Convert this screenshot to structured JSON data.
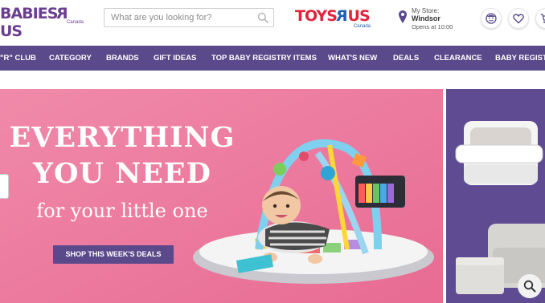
{
  "header": {
    "babies_logo": {
      "word": "BABIES",
      "r": "R",
      "us": "US",
      "canada": "Canada"
    },
    "search": {
      "placeholder": "What are you looking for?"
    },
    "toys_logo": {
      "toys": "TOYS",
      "r": "R",
      "us": "US",
      "canada": "Canada"
    },
    "store": {
      "label": "My Store:",
      "name": "Windsor",
      "hours": "Opens at 10:00"
    },
    "icons": [
      "account-icon",
      "heart-icon",
      "cart-icon"
    ]
  },
  "nav": {
    "items": [
      {
        "label": "\"R\" CLUB"
      },
      {
        "label": "CATEGORY"
      },
      {
        "label": "BRANDS"
      },
      {
        "label": "GIFT IDEAS"
      },
      {
        "label": "TOP BABY REGISTRY ITEMS"
      },
      {
        "label": "WHAT'S NEW"
      },
      {
        "label": "DEALS"
      },
      {
        "label": "CLEARANCE"
      },
      {
        "label": "BABY REGISTRY"
      }
    ]
  },
  "hero": {
    "line1": "EVERYTHING",
    "line2": "YOU NEED",
    "subline": "for your little one",
    "cta": "SHOP THIS WEEK'S DEALS"
  },
  "colors": {
    "brand_purple": "#5b4a8b",
    "hero_pink": "#ee7a9f",
    "babies_logo_purple": "#6a3f8f"
  }
}
